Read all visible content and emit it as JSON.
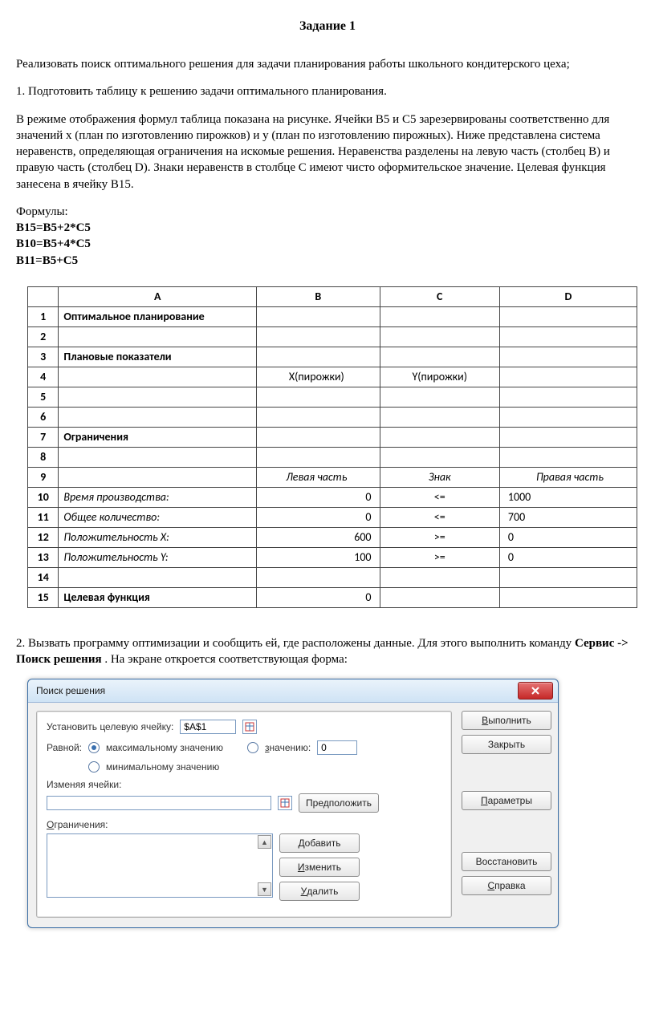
{
  "title": "Задание 1",
  "intro": "Реализовать поиск оптимального решения для задачи планирования работы школьного кондитерского цеха;",
  "step1": "1. Подготовить таблицу к решению задачи оптимального планирования.",
  "desc": "В режиме отображения формул таблица показана на рисунке. Ячейки B5 и C5 зарезервированы соответственно для значений x (план по изготовлению пирожков) и y (план по изготовлению пирожных). Ниже представлена система неравенств, определяющая ограничения на искомые решения. Неравенства разделены на левую часть (столбец B) и правую часть (столбец D). Знаки неравенств в столбце C имеют чисто оформительское значение. Целевая функция занесена в ячейку B15.",
  "formulas_label": "Формулы:",
  "formulas": {
    "f1": "B15=B5+2*C5",
    "f2": "B10=B5+4*C5",
    "f3": "B11=B5+C5"
  },
  "sheet": {
    "headers": {
      "A": "A",
      "B": "B",
      "C": "C",
      "D": "D"
    },
    "rows": [
      {
        "n": "1",
        "A": "Оптимальное планирование",
        "A_bold": true
      },
      {
        "n": "2"
      },
      {
        "n": "3",
        "A": "Плановые показатели",
        "A_bold": true
      },
      {
        "n": "4",
        "B": "X(пирожки)",
        "B_center": true,
        "C": "Y(пирожки)"
      },
      {
        "n": "5"
      },
      {
        "n": "6"
      },
      {
        "n": "7",
        "A": "Ограничения",
        "A_bold": true
      },
      {
        "n": "8"
      },
      {
        "n": "9",
        "B": "Левая часть",
        "B_italic": true,
        "B_center": true,
        "C": "Знак",
        "C_italic": true,
        "D": "Правая часть",
        "D_italic": true,
        "D_center": true
      },
      {
        "n": "10",
        "A": "Время производства:",
        "A_italic": true,
        "B": "0",
        "C": "<=",
        "D": "1000"
      },
      {
        "n": "11",
        "A": "Общее количество:",
        "A_italic": true,
        "B": "0",
        "C": "<=",
        "D": "700"
      },
      {
        "n": "12",
        "A": "Положительность X:",
        "A_italic": true,
        "B": "600",
        "C": ">=",
        "D": "0"
      },
      {
        "n": "13",
        "A": "Положительность Y:",
        "A_italic": true,
        "B": "100",
        "C": ">=",
        "D": "0"
      },
      {
        "n": "14"
      },
      {
        "n": "15",
        "A": "Целевая функция",
        "A_bold": true,
        "B": "0"
      }
    ]
  },
  "step2a": "2. Вызвать программу оптимизации и сообщить ей, где расположены данные. Для этого выполнить команду ",
  "step2b": "Сервис -> Поиск решения",
  "step2c": ". На экране откроется соответствующая форма:",
  "solver": {
    "title": "Поиск решения",
    "target_label": "Установить целевую ячейку:",
    "target_value": "$A$1",
    "equal_label": "Равной:",
    "opt_max_pre": "м",
    "opt_max_rest": "аксимальному значению",
    "opt_val_pre": "з",
    "opt_val_rest": "начению:",
    "value_field": "0",
    "opt_min_pre": "ми",
    "opt_min_rest": "нимальному значению",
    "changing_label": "Изменяя ячейки:",
    "constraints_label_pre": "О",
    "constraints_label_rest": "граничения:",
    "btn_guess_pre": "Предполо",
    "btn_guess_rest": "жить",
    "btn_add_pre": "Д",
    "btn_add_rest": "обавить",
    "btn_change_pre": "И",
    "btn_change_rest": "зменить",
    "btn_delete_pre": "У",
    "btn_delete_rest": "далить",
    "btn_run_pre": "В",
    "btn_run_rest": "ыполнить",
    "btn_close": "Закрыть",
    "btn_params_pre": "П",
    "btn_params_rest": "араметры",
    "btn_restore": "Восстановить",
    "btn_help_pre": "С",
    "btn_help_rest": "правка"
  }
}
